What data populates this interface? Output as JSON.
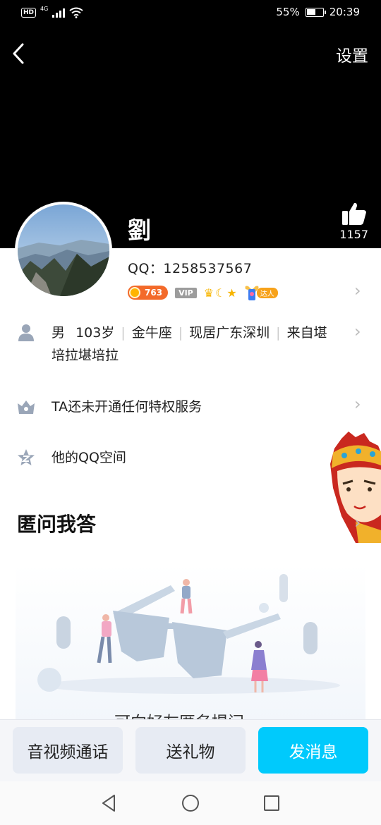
{
  "status_bar": {
    "network_badge": "HD",
    "network_type": "4G",
    "battery_percent": "55%",
    "battery_level": 0.55,
    "time": "20:39"
  },
  "header": {
    "back_icon": "chevron-left-icon",
    "settings_label": "设置"
  },
  "profile": {
    "name": "劉",
    "likes": "1157",
    "qq_label": "QQ：",
    "qq_number": "1258537567",
    "level": "763",
    "vip_label": "VIP",
    "daren_label": "达人"
  },
  "info_rows": {
    "basic": {
      "icon": "person-icon",
      "gender": "男",
      "age": "103岁",
      "zodiac": "金牛座",
      "location": "现居广东深圳",
      "origin_line1": "来自堪",
      "origin_line2": "培拉堪培拉"
    },
    "privilege": {
      "icon": "crown-icon",
      "text": "TA还未开通任何特权服务"
    },
    "qzone": {
      "icon": "star-z-icon",
      "text": "他的QQ空间"
    }
  },
  "section": {
    "title": "匿问我答",
    "caption": "可向好友匿名提问"
  },
  "actions": {
    "call": "音视频通话",
    "gift": "送礼物",
    "message": "发消息"
  },
  "colors": {
    "header_bg": "#000000",
    "accent": "#00cafc",
    "grey_button": "#e7ebf3"
  }
}
